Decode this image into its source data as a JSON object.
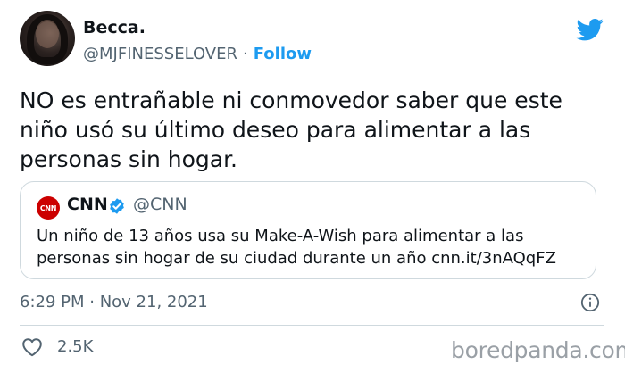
{
  "author": {
    "name": "Becca.",
    "handle": "@MJFINESSELOVER",
    "separator": "·",
    "follow_label": "Follow"
  },
  "tweet": {
    "text": "NO es entrañable ni conmovedor saber que este niño usó su último deseo para alimentar a las personas sin hogar."
  },
  "quote": {
    "logo_text": "CNN",
    "name": "CNN",
    "handle": "@CNN",
    "text": "Un niño de 13 años usa su Make-A-Wish para alimentar a las personas sin hogar de su ciudad durante un año cnn.it/3nAQqFZ"
  },
  "meta": {
    "timestamp": "6:29 PM · Nov 21, 2021"
  },
  "actions": {
    "likes": "2.5K"
  },
  "watermark": "boredpanda.com",
  "colors": {
    "accent": "#1d9bf0",
    "secondary_text": "#536471",
    "cnn_red": "#cc0000"
  },
  "icons": {
    "brand": "twitter-bird-icon",
    "verified": "verified-badge-icon",
    "info": "info-icon",
    "like": "heart-icon"
  }
}
